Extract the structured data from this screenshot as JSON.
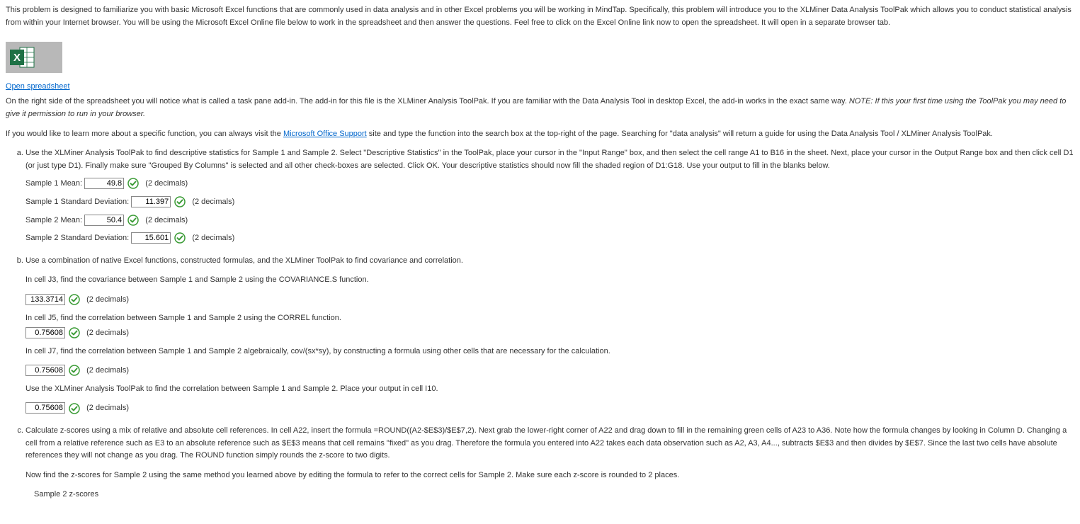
{
  "intro": {
    "p1": "This problem is designed to familiarize you with basic Microsoft Excel functions that are commonly used in data analysis and in other Excel problems you will be working in MindTap. Specifically, this problem will introduce you to the XLMiner Data Analysis ToolPak which allows you to conduct statistical analysis from within your Internet browser. You will be using the Microsoft Excel Online file below to work in the spreadsheet and then answer the questions. Feel free to click on the Excel Online link now to open the spreadsheet. It will open in a separate browser tab."
  },
  "excel_link": {
    "label": "Open spreadsheet"
  },
  "task_pane": {
    "text_before_note": "On the right side of the spreadsheet you will notice what is called a task pane add-in. The add-in for this file is the XLMiner Analysis ToolPak. If you are familiar with the Data Analysis Tool in desktop Excel, the add-in works in the exact same way. ",
    "note": "NOTE: If this your first time using the ToolPak you may need to give it permission to run in your browser."
  },
  "learn_more": {
    "before_link": "If you would like to learn more about a specific function, you can always visit the ",
    "link_text": "Microsoft Office Support",
    "after_link": " site and type the function into the search box at the top-right of the page. Searching for \"data analysis\" will return a guide for using the Data Analysis Tool / XLMiner Analysis ToolPak."
  },
  "part_a": {
    "text": "Use the XLMiner Analysis ToolPak to find descriptive statistics for Sample 1 and Sample 2. Select \"Descriptive Statistics\" in the ToolPak, place your cursor in the \"Input Range\" box, and then select the cell range A1 to B16 in the sheet. Next, place your cursor in the Output Range box and then click cell D1 (or just type D1). Finally make sure \"Grouped By Columns\" is selected and all other check-boxes are selected. Click OK. Your descriptive statistics should now fill the shaded region of D1:G18. Use your output to fill in the blanks below.",
    "sample1_mean_label": "Sample 1 Mean:",
    "sample1_mean_value": "49.8",
    "sample1_sd_label": "Sample 1 Standard Deviation:",
    "sample1_sd_value": "11.397",
    "sample2_mean_label": "Sample 2 Mean:",
    "sample2_mean_value": "50.4",
    "sample2_sd_label": "Sample 2 Standard Deviation:",
    "sample2_sd_value": "15.601",
    "decimals": "(2 decimals)"
  },
  "part_b": {
    "text": "Use a combination of native Excel functions, constructed formulas, and the XLMiner ToolPak to find covariance and correlation.",
    "j3_text": "In cell J3, find the covariance between Sample 1 and Sample 2 using the COVARIANCE.S function.",
    "j3_value": "133.3714",
    "j5_text": "In cell J5, find the correlation between Sample 1 and Sample 2 using the CORREL function.",
    "j5_value": "0.75608",
    "j7_text": "In cell J7, find the correlation between Sample 1 and Sample 2 algebraically, cov/(sx*sy), by constructing a formula using other cells that are necessary for the calculation.",
    "j7_value": "0.75608",
    "i10_text": "Use the XLMiner Analysis ToolPak to find the correlation between Sample 1 and Sample 2. Place your output in cell I10.",
    "i10_value": "0.75608",
    "decimals": "(2 decimals)"
  },
  "part_c": {
    "text": "Calculate z-scores using a mix of relative and absolute cell references. In cell A22, insert the formula =ROUND((A2-$E$3)/$E$7,2). Next grab the lower-right corner of A22 and drag down to fill in the remaining green cells of A23 to A36. Note how the formula changes by looking in Column D. Changing a cell from a relative reference such as E3 to an absolute reference such as $E$3 means that cell remains \"fixed\" as you drag. Therefore the formula you entered into A22 takes each data observation such as A2, A3, A4..., subtracts $E$3 and then divides by $E$7. Since the last two cells have absolute references they will not change as you drag. The ROUND function simply rounds the z-score to two digits.",
    "sample2_text": "Now find the z-scores for Sample 2 using the same method you learned above by editing the formula to refer to the correct cells for Sample 2. Make sure each z-score is rounded to 2 places.",
    "zscores_heading": "Sample 2 z-scores"
  }
}
